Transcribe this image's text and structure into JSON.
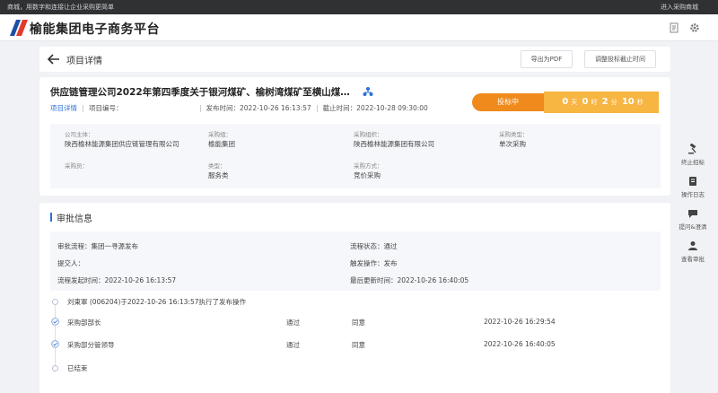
{
  "topbar": {
    "slogan": "商城，用数字和连接让企业采购更简单",
    "enter_mall": "进入采购商城"
  },
  "header": {
    "brand": "榆能集团电子商务平台",
    "icons": [
      "document-icon",
      "gear-icon"
    ]
  },
  "page": {
    "title": "项目详情",
    "export_pdf": "导出为PDF",
    "adjust_deadline": "调整投标截止时间"
  },
  "project": {
    "title": "供应链管理公司2022年第四季度关于银河煤矿、榆树湾煤矿至横山煤…",
    "detail_link": "项目详情",
    "code_label": "项目编号：",
    "code_value": "",
    "publish_time": "发布时间：2022-10-26 16:13:57",
    "deadline": "截止时间：2022-10-28 09:30:00",
    "status": "投标中",
    "countdown": {
      "days": "0",
      "days_unit": "天",
      "hours": "0",
      "hours_unit": "时",
      "minutes": "2",
      "minutes_unit": "分",
      "seconds": "10",
      "seconds_unit": "秒"
    },
    "fields": [
      {
        "label": "公司主体：",
        "value": "陕西榆林能源集团供应链管理有限公司"
      },
      {
        "label": "采购组：",
        "value": "榆能集团"
      },
      {
        "label": "采购组织：",
        "value": "陕西榆林能源集团有限公司"
      },
      {
        "label": "采购类型：",
        "value": "单次采购"
      },
      {
        "label": "采购员：",
        "value": ""
      },
      {
        "label": "类型：",
        "value": "服务类"
      },
      {
        "label": "采购方式：",
        "value": "竞价采购"
      }
    ]
  },
  "approval": {
    "section_title": "审批信息",
    "flow": "审批流程：集团一寻源发布",
    "flow_status": "流程状态：通过",
    "submitter": "提交人：",
    "trigger": "触发操作：发布",
    "start_time": "流程发起时间：2022-10-26 16:13:57",
    "last_update": "最后更新时间：2022-10-26 16:40:05",
    "timeline": [
      {
        "text": "刘東軍 (006204)于2022-10-26 16:13:57执行了发布操作",
        "result": "",
        "opinion": "",
        "time": ""
      },
      {
        "text": "采购部部长",
        "result": "通过",
        "opinion": "同意",
        "time": "2022-10-26 16:29:54"
      },
      {
        "text": "采购部分管领导",
        "result": "通过",
        "opinion": "同意",
        "time": "2022-10-26 16:40:05"
      },
      {
        "text": "已结束",
        "result": "",
        "opinion": "",
        "time": ""
      }
    ]
  },
  "rail": [
    {
      "label": "终止招标",
      "icon": "gavel-icon"
    },
    {
      "label": "操作日志",
      "icon": "log-icon"
    },
    {
      "label": "提问&澄清",
      "icon": "chat-icon"
    },
    {
      "label": "查看审批",
      "icon": "approver-icon"
    }
  ],
  "colors": {
    "accent": "#2d6fd6",
    "status_orange": "#f08a1c",
    "countdown_yellow": "#f7b541"
  }
}
